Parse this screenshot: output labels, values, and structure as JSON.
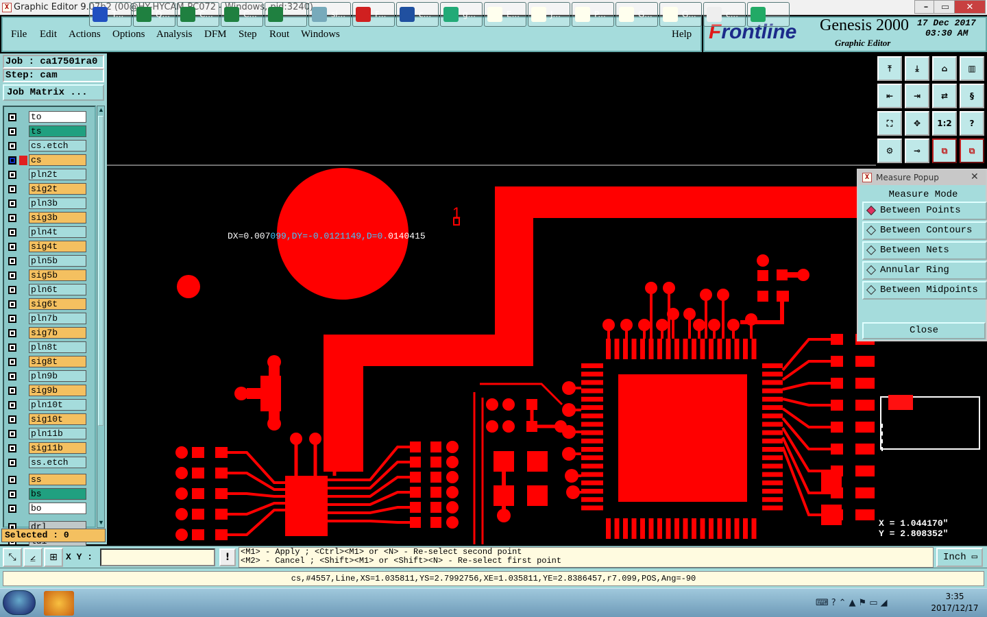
{
  "window": {
    "title": "Graphic Editor 9.07b2 (00@HY-HYCAM-PC072 - Windows, pid:3240)",
    "icon": "app-x-icon"
  },
  "menu": {
    "items": [
      "File",
      "Edit",
      "Actions",
      "Options",
      "Analysis",
      "DFM",
      "Step",
      "Rout",
      "Windows"
    ],
    "help": "Help"
  },
  "brand": {
    "logo_first": "F",
    "logo_rest": "rontline",
    "product": "Genesis 2000",
    "subtitle": "Graphic Editor",
    "date": "17 Dec 2017",
    "time": "03:30 AM"
  },
  "left": {
    "job": "Job : ca17501ra0",
    "step": "Step: cam",
    "job_matrix": "Job Matrix ...",
    "selected": "Selected : 0"
  },
  "layers": [
    {
      "name": "to",
      "color": "#ffffff"
    },
    {
      "name": "ts",
      "color": "#20a080"
    },
    {
      "name": "cs.etch",
      "color": "#a5dcdc"
    },
    {
      "name": "cs",
      "color": "#f4c060",
      "active": true
    },
    {
      "name": "pln2t",
      "color": "#a5dcdc"
    },
    {
      "name": "sig2t",
      "color": "#f4c060"
    },
    {
      "name": "pln3b",
      "color": "#a5dcdc"
    },
    {
      "name": "sig3b",
      "color": "#f4c060"
    },
    {
      "name": "pln4t",
      "color": "#a5dcdc"
    },
    {
      "name": "sig4t",
      "color": "#f4c060"
    },
    {
      "name": "pln5b",
      "color": "#a5dcdc"
    },
    {
      "name": "sig5b",
      "color": "#f4c060"
    },
    {
      "name": "pln6t",
      "color": "#a5dcdc"
    },
    {
      "name": "sig6t",
      "color": "#f4c060"
    },
    {
      "name": "pln7b",
      "color": "#a5dcdc"
    },
    {
      "name": "sig7b",
      "color": "#f4c060"
    },
    {
      "name": "pln8t",
      "color": "#a5dcdc"
    },
    {
      "name": "sig8t",
      "color": "#f4c060"
    },
    {
      "name": "pln9b",
      "color": "#a5dcdc"
    },
    {
      "name": "sig9b",
      "color": "#f4c060"
    },
    {
      "name": "pln10t",
      "color": "#a5dcdc"
    },
    {
      "name": "sig10t",
      "color": "#f4c060"
    },
    {
      "name": "pln11b",
      "color": "#a5dcdc"
    },
    {
      "name": "sig11b",
      "color": "#f4c060"
    },
    {
      "name": "ss.etch",
      "color": "#a5dcdc"
    },
    {
      "name": "ss",
      "color": "#f4c060"
    },
    {
      "name": "bs",
      "color": "#20a080"
    },
    {
      "name": "bo",
      "color": "#ffffff"
    },
    {
      "name": "drl",
      "color": "#c0c8c8"
    },
    {
      "name": "ldi",
      "color": "#c0c8c8"
    }
  ],
  "measure": {
    "readout_white_1": "DX=0.007",
    "readout_blue": "099,DY=-0.0121149,D=0.",
    "readout_white_2": "0140415",
    "marker": "1"
  },
  "measure_popup": {
    "title": "Measure Popup",
    "close_x": "✕",
    "mode_label": "Measure Mode",
    "options": [
      "Between Points",
      "Between Contours",
      "Between Nets",
      "Annular Ring",
      "Between Midpoints"
    ],
    "selected": "Between Points",
    "close_button": "Close"
  },
  "toolbox": {
    "icons": [
      "layer-up-icon",
      "layer-down-icon",
      "home-icon",
      "panel-icon",
      "move-left-icon",
      "move-right-icon",
      "swap-icon",
      "scroll-icon",
      "fit-icon",
      "center-icon",
      "scale-icon",
      "help-icon",
      "tools-icon",
      "probe-icon",
      "net-icon",
      "net-highlight-icon"
    ],
    "scale_label": "1:2",
    "help_label": "?"
  },
  "coords": {
    "x": "X = 1.044170\"",
    "y": "Y = 2.808352\""
  },
  "cmd": {
    "xy_label": "X Y :",
    "xy_value": "",
    "bang": "!",
    "hint1": "<M1> - Apply  ; <Ctrl><M1> or <N> - Re-select second point",
    "hint2": "<M2> - Cancel ; <Shift><M1> or <Shift><N> - Re-select first point",
    "unit": "Inch"
  },
  "status": "cs,#4557,Line,XS=1.035811,YS=2.7992756,XE=1.035811,YE=2.8386457,r7.099,POS,Ang=-90",
  "taskbar": {
    "items": [
      {
        "label": "T...",
        "icon": "floppy-icon",
        "color": "#2050c0"
      },
      {
        "label": "Q...",
        "icon": "excel-icon",
        "color": "#1f8040"
      },
      {
        "label": "C...",
        "icon": "excel-icon",
        "color": "#1f8040"
      },
      {
        "label": "C...",
        "icon": "excel-icon",
        "color": "#1f8040"
      },
      {
        "label": "",
        "icon": "excel-icon",
        "color": "#1f8040"
      },
      {
        "label": "si...",
        "icon": "notepad-icon",
        "color": "#7ab"
      },
      {
        "label": "F...",
        "icon": "foxit-icon",
        "color": "#d02020"
      },
      {
        "label": "c...",
        "icon": "word-icon",
        "color": "#2050a0"
      },
      {
        "label": "g...",
        "icon": "viewer-icon",
        "color": "#2a7"
      },
      {
        "label": "E...",
        "icon": "genesis-icon",
        "color": "#ffe"
      },
      {
        "label": "J...",
        "icon": "genesis-icon",
        "color": "#ffe"
      },
      {
        "label": "P...",
        "icon": "genesis-icon",
        "color": "#ffe"
      },
      {
        "label": "G...",
        "icon": "genesis-icon",
        "color": "#ffe"
      },
      {
        "label": "G...",
        "icon": "genesis-icon",
        "color": "#ffe"
      },
      {
        "label": "c...",
        "icon": "acrobat-icon",
        "color": "#eee"
      },
      {
        "label": "",
        "icon": "app-p-icon",
        "color": "#2a6"
      }
    ],
    "clock_time": "3:35",
    "clock_date": "2017/12/17"
  }
}
